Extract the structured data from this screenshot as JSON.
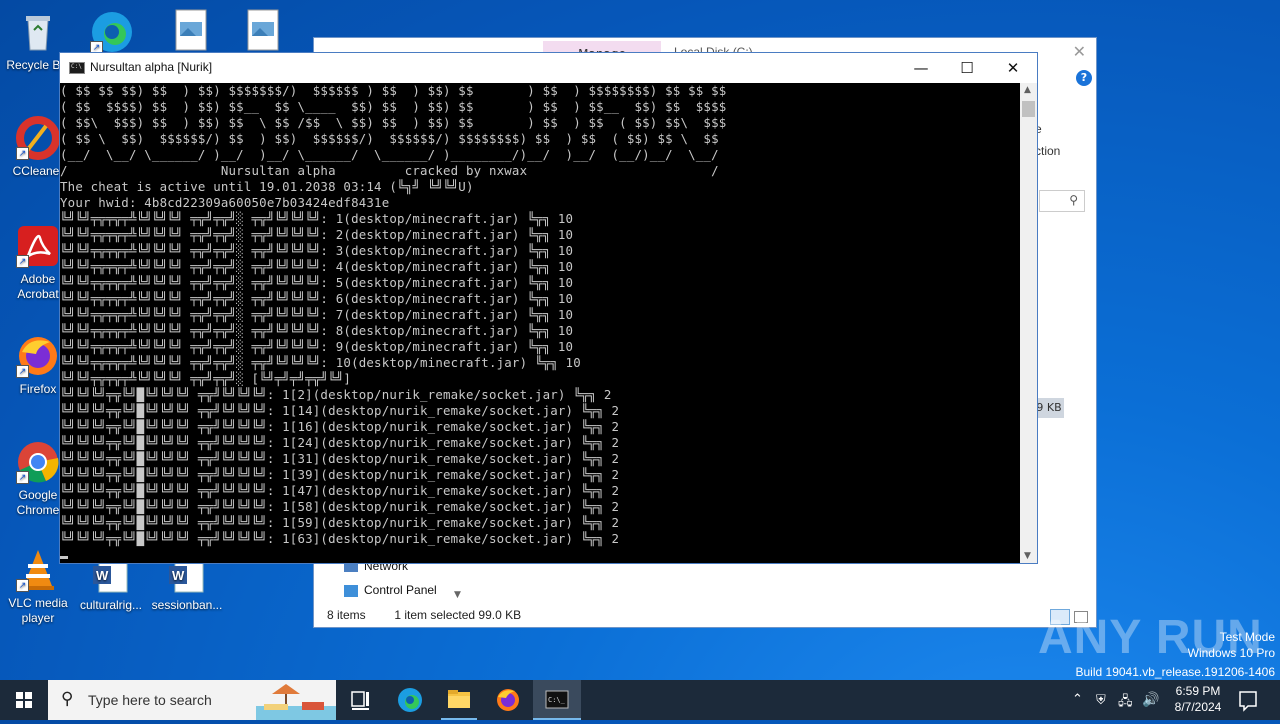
{
  "desktop": {
    "icons": [
      {
        "label": "Recycle Bin",
        "icon": "recycle-bin-icon"
      },
      {
        "label": "CCleaner",
        "icon": "ccleaner-icon"
      },
      {
        "label": "Adobe Acrobat",
        "icon": "acrobat-icon"
      },
      {
        "label": "Firefox",
        "icon": "firefox-icon"
      },
      {
        "label": "Google Chrome",
        "icon": "chrome-icon"
      },
      {
        "label": "VLC media player",
        "icon": "vlc-icon"
      },
      {
        "label": "culturalrig...",
        "icon": "word-doc-icon"
      },
      {
        "label": "sessionban...",
        "icon": "word-doc-icon"
      }
    ]
  },
  "explorer": {
    "manage_tab": "Manage",
    "title": "Local Disk (C:)",
    "side_text_1": "e",
    "side_text_2": "ction",
    "nav_items": [
      "Network",
      "Control Panel"
    ],
    "status_items": "8 items",
    "status_selected": "1 item selected  99.0 KB",
    "size_badge": "9 KB"
  },
  "console": {
    "title": "Nursultan alpha [Nurik]",
    "minimize": "—",
    "maximize": "☐",
    "close": "✕",
    "lines": [
      "( $$ $$ $$) $$  ) $$) $$$$$$$/)  $$$$$$ ) $$  ) $$) $$       ) $$  ) $$$$$$$$) $$ $$ $$",
      "( $$  $$$$) $$  ) $$) $$__  $$ \\____  $$) $$  ) $$) $$       ) $$  ) $$__  $$) $$  $$$$",
      "( $$\\  $$$) $$  ) $$) $$  \\ $$ /$$  \\ $$) $$  ) $$) $$       ) $$  ) $$  ( $$) $$\\  $$$",
      "( $$ \\  $$)  $$$$$$/) $$  ) $$)  $$$$$$/)  $$$$$$/) $$$$$$$$) $$  ) $$  ( $$) $$ \\  $$",
      "(__/  \\__/ \\______/ )__/  )__/ \\______/  \\______/ )________/)__/  )__/  (__/)__/  \\__/",
      "/                    Nursultan alpha         cracked by nxwax                        /",
      "The cheat is active until 19.01.2038 03:14 (╚╗╝ ╚╝╚╝U)",
      "Your hwid: 4b8cd22309a60050e7b03424edf8431e",
      "╚╝╚╝╤╦╤╦╤╩╚╝╚╝╚╝ ╤╦╝╤╦╝░ ╤╦╝╚╝╚╝╚╝: 1(desktop/minecraft.jar) ╚╦╗ 10",
      "╚╝╚╝╤╦╤╦╤╩╚╝╚╝╚╝ ╤╦╝╤╦╝░ ╤╦╝╚╝╚╝╚╝: 2(desktop/minecraft.jar) ╚╦╗ 10",
      "╚╝╚╝╤╦╤╦╤╩╚╝╚╝╚╝ ╤╦╝╤╦╝░ ╤╦╝╚╝╚╝╚╝: 3(desktop/minecraft.jar) ╚╦╗ 10",
      "╚╝╚╝╤╦╤╦╤╩╚╝╚╝╚╝ ╤╦╝╤╦╝░ ╤╦╝╚╝╚╝╚╝: 4(desktop/minecraft.jar) ╚╦╗ 10",
      "╚╝╚╝╤╦╤╦╤╩╚╝╚╝╚╝ ╤╦╝╤╦╝░ ╤╦╝╚╝╚╝╚╝: 5(desktop/minecraft.jar) ╚╦╗ 10",
      "╚╝╚╝╤╦╤╦╤╩╚╝╚╝╚╝ ╤╦╝╤╦╝░ ╤╦╝╚╝╚╝╚╝: 6(desktop/minecraft.jar) ╚╦╗ 10",
      "╚╝╚╝╤╦╤╦╤╩╚╝╚╝╚╝ ╤╦╝╤╦╝░ ╤╦╝╚╝╚╝╚╝: 7(desktop/minecraft.jar) ╚╦╗ 10",
      "╚╝╚╝╤╦╤╦╤╩╚╝╚╝╚╝ ╤╦╝╤╦╝░ ╤╦╝╚╝╚╝╚╝: 8(desktop/minecraft.jar) ╚╦╗ 10",
      "╚╝╚╝╤╦╤╦╤╩╚╝╚╝╚╝ ╤╦╝╤╦╝░ ╤╦╝╚╝╚╝╚╝: 9(desktop/minecraft.jar) ╚╦╗ 10",
      "╚╝╚╝╤╦╤╦╤╩╚╝╚╝╚╝ ╤╦╝╤╦╝░ ╤╦╝╚╝╚╝╚╝: 10(desktop/minecraft.jar) ╚╦╗ 10",
      "╚╝╚╝╤╦╤╦╤╩╚╝╚╝╚╝ ╤╦╝╤╦╝░ [╚╝╤╝╤╝╤╦╝╚╝]",
      "╚╝╚╝╚╝╤╦╚╝█╚╝╚╝╚╝ ╤╦╝╚╝╚╝╚╝: 1[2](desktop/nurik_remake/socket.jar) ╚╦╗ 2",
      "╚╝╚╝╚╝╤╦╚╝█╚╝╚╝╚╝ ╤╦╝╚╝╚╝╚╝: 1[14](desktop/nurik_remake/socket.jar) ╚╦╗ 2",
      "╚╝╚╝╚╝╤╦╚╝█╚╝╚╝╚╝ ╤╦╝╚╝╚╝╚╝: 1[16](desktop/nurik_remake/socket.jar) ╚╦╗ 2",
      "╚╝╚╝╚╝╤╦╚╝█╚╝╚╝╚╝ ╤╦╝╚╝╚╝╚╝: 1[24](desktop/nurik_remake/socket.jar) ╚╦╗ 2",
      "╚╝╚╝╚╝╤╦╚╝█╚╝╚╝╚╝ ╤╦╝╚╝╚╝╚╝: 1[31](desktop/nurik_remake/socket.jar) ╚╦╗ 2",
      "╚╝╚╝╚╝╤╦╚╝█╚╝╚╝╚╝ ╤╦╝╚╝╚╝╚╝: 1[39](desktop/nurik_remake/socket.jar) ╚╦╗ 2",
      "╚╝╚╝╚╝╤╦╚╝█╚╝╚╝╚╝ ╤╦╝╚╝╚╝╚╝: 1[47](desktop/nurik_remake/socket.jar) ╚╦╗ 2",
      "╚╝╚╝╚╝╤╦╚╝█╚╝╚╝╚╝ ╤╦╝╚╝╚╝╚╝: 1[58](desktop/nurik_remake/socket.jar) ╚╦╗ 2",
      "╚╝╚╝╚╝╤╦╚╝█╚╝╚╝╚╝ ╤╦╝╚╝╚╝╚╝: 1[59](desktop/nurik_remake/socket.jar) ╚╦╗ 2",
      "╚╝╚╝╚╝╤╦╚╝█╚╝╚╝╚╝ ╤╦╝╚╝╚╝╚╝: 1[63](desktop/nurik_remake/socket.jar) ╚╦╗ 2"
    ]
  },
  "watermark": {
    "brand": "ANY RUN",
    "mode": "Test Mode",
    "edition": "Windows 10 Pro",
    "build": "Build 19041.vb_release.191206-1406"
  },
  "taskbar": {
    "search_placeholder": "Type here to search",
    "time": "6:59 PM",
    "date": "8/7/2024"
  },
  "colors": {
    "desktop": "#0a63c9",
    "taskbar": "#1c2a3a",
    "console_bg": "#000000",
    "console_text": "#c8c8c8"
  }
}
